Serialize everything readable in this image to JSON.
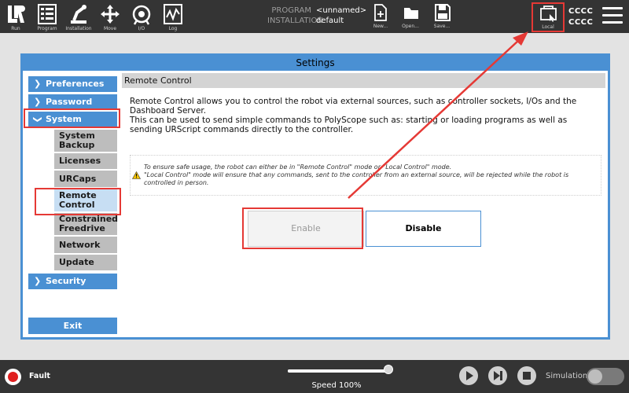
{
  "toolbar": {
    "items": [
      {
        "label": "Run",
        "icon": "ur-logo-icon"
      },
      {
        "label": "Program",
        "icon": "program-icon"
      },
      {
        "label": "Installation",
        "icon": "installation-icon"
      },
      {
        "label": "Move",
        "icon": "move-arrows-icon"
      },
      {
        "label": "I/O",
        "icon": "io-icon"
      },
      {
        "label": "Log",
        "icon": "log-icon"
      }
    ],
    "program_key": "PROGRAM",
    "program_value": "<unnamed>",
    "installation_key": "INSTALLATION",
    "installation_value": "default",
    "new_label": "New...",
    "open_label": "Open...",
    "save_label": "Save...",
    "local_label": "Local",
    "robot_id_line1": "CCCC",
    "robot_id_line2": "CCCC"
  },
  "settings": {
    "title": "Settings",
    "nav": {
      "preferences": "Preferences",
      "password": "Password",
      "system": "System",
      "security": "Security",
      "exit": "Exit",
      "system_items": {
        "system_backup": "System Backup",
        "licenses": "Licenses",
        "urcaps": "URCaps",
        "remote_control": "Remote Control",
        "constrained_freedrive": "Constrained Freedrive",
        "network": "Network",
        "update": "Update"
      }
    },
    "remote_control": {
      "header": "Remote Control",
      "description_1": "Remote Control allows you to control the robot via external sources, such as controller sockets, I/Os and the Dashboard Server.",
      "description_2": "This can be used to send simple commands to PolyScope such as: starting or loading programs as well as sending URScript commands directly to the controller.",
      "notice_1": "To ensure safe usage, the robot can either be in \"Remote Control\" mode or \"Local Control\" mode.",
      "notice_2": "\"Local Control\" mode will ensure that any commands, sent to the controller from an external source, will be rejected while the robot is controlled in person.",
      "enable_label": "Enable",
      "disable_label": "Disable"
    }
  },
  "footer": {
    "status_label": "Fault",
    "speed_label": "Speed 100%",
    "speed_fraction": 1.0,
    "simulation_label": "Simulation"
  },
  "colors": {
    "accent": "#4a90d3",
    "bar": "#343434",
    "highlight": "#e53935",
    "fault": "#e02020"
  }
}
